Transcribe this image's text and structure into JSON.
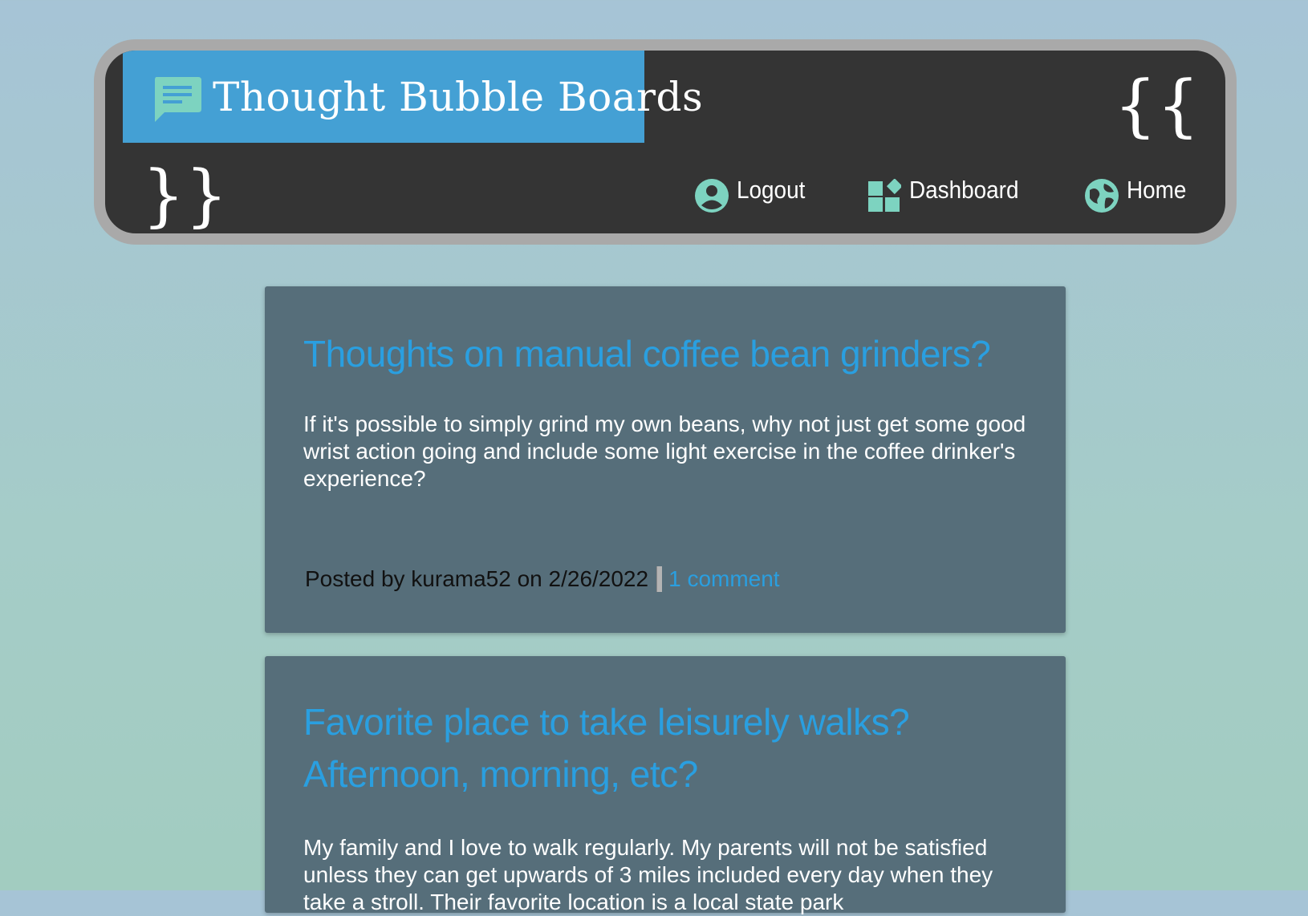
{
  "header": {
    "brand_title": "Thought Bubble Boards",
    "brace_open": "{{",
    "brace_close": "}}",
    "nav": [
      {
        "label": "Logout",
        "icon": "account-circle-icon"
      },
      {
        "label": "Dashboard",
        "icon": "dashboard-icon"
      },
      {
        "label": "Home",
        "icon": "globe-icon"
      }
    ]
  },
  "posts": [
    {
      "title": "Thoughts on manual coffee bean grinders?",
      "body": "If it's possible to simply grind my own beans, why not just get some good wrist action going and include some light exercise in the coffee drinker's experience?",
      "meta_prefix": "Posted by kurama52 on 2/26/2022",
      "comments_link": "1 comment"
    },
    {
      "title": "Favorite place to take leisurely walks? Afternoon, morning, etc?",
      "body": "My family and I love to walk regularly. My parents will not be satisfied unless they can get upwards of 3 miles included every day when they take a stroll. Their favorite location is a local state park"
    }
  ],
  "colors": {
    "brand_bg": "#44a0d4",
    "header_bg": "#343434",
    "header_border": "#a9a9a9",
    "icon_accent": "#7dd3c0",
    "post_bg": "#566e7a",
    "link": "#2a9fe0"
  }
}
